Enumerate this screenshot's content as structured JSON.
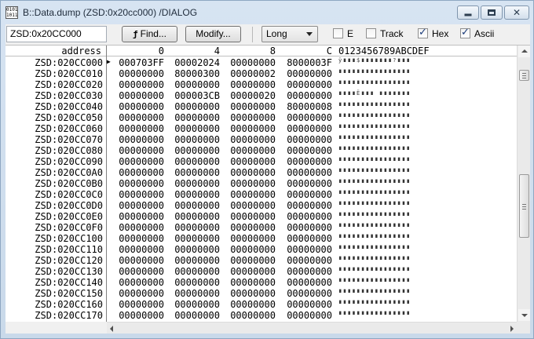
{
  "window": {
    "title": "B::Data.dump (ZSD:0x20cc000) /DIALOG",
    "icon_text": "0101 1011",
    "controls": [
      "minimize",
      "maximize",
      "close"
    ]
  },
  "toolbar": {
    "address_value": "ZSD:0x20CC000",
    "find_label": "Find...",
    "modify_label": "Modify...",
    "width_select": "Long",
    "checkboxes": [
      {
        "label": "E",
        "checked": false
      },
      {
        "label": "Track",
        "checked": false
      },
      {
        "label": "Hex",
        "checked": true
      },
      {
        "label": "Ascii",
        "checked": true
      }
    ]
  },
  "dump": {
    "header": {
      "address": "address",
      "columns": [
        "0",
        "4",
        "8",
        "C"
      ],
      "ascii": "0123456789ABCDEF"
    },
    "rows": [
      {
        "addr": "ZSD:020CC000",
        "words": [
          "000703FF",
          "00002024",
          "00000000",
          "8000003F"
        ],
        "ascii": "ÿ∎∎∎$∎∎∎∎∎∎∎?∎∎∎",
        "current": true
      },
      {
        "addr": "ZSD:020CC010",
        "words": [
          "00000000",
          "80000300",
          "00000002",
          "00000000"
        ],
        "ascii": "∎∎∎∎∎∎∎∎∎∎∎∎∎∎∎∎"
      },
      {
        "addr": "ZSD:020CC020",
        "words": [
          "00000000",
          "00000000",
          "00000000",
          "00000000"
        ],
        "ascii": "∎∎∎∎∎∎∎∎∎∎∎∎∎∎∎∎"
      },
      {
        "addr": "ZSD:020CC030",
        "words": [
          "00000000",
          "000003CB",
          "00000020",
          "00000000"
        ],
        "ascii": "∎∎∎∎Ë∎∎∎ ∎∎∎∎∎∎∎"
      },
      {
        "addr": "ZSD:020CC040",
        "words": [
          "00000000",
          "00000000",
          "00000000",
          "80000008"
        ],
        "ascii": "∎∎∎∎∎∎∎∎∎∎∎∎∎∎∎∎"
      },
      {
        "addr": "ZSD:020CC050",
        "words": [
          "00000000",
          "00000000",
          "00000000",
          "00000000"
        ],
        "ascii": "∎∎∎∎∎∎∎∎∎∎∎∎∎∎∎∎"
      },
      {
        "addr": "ZSD:020CC060",
        "words": [
          "00000000",
          "00000000",
          "00000000",
          "00000000"
        ],
        "ascii": "∎∎∎∎∎∎∎∎∎∎∎∎∎∎∎∎"
      },
      {
        "addr": "ZSD:020CC070",
        "words": [
          "00000000",
          "00000000",
          "00000000",
          "00000000"
        ],
        "ascii": "∎∎∎∎∎∎∎∎∎∎∎∎∎∎∎∎"
      },
      {
        "addr": "ZSD:020CC080",
        "words": [
          "00000000",
          "00000000",
          "00000000",
          "00000000"
        ],
        "ascii": "∎∎∎∎∎∎∎∎∎∎∎∎∎∎∎∎"
      },
      {
        "addr": "ZSD:020CC090",
        "words": [
          "00000000",
          "00000000",
          "00000000",
          "00000000"
        ],
        "ascii": "∎∎∎∎∎∎∎∎∎∎∎∎∎∎∎∎"
      },
      {
        "addr": "ZSD:020CC0A0",
        "words": [
          "00000000",
          "00000000",
          "00000000",
          "00000000"
        ],
        "ascii": "∎∎∎∎∎∎∎∎∎∎∎∎∎∎∎∎"
      },
      {
        "addr": "ZSD:020CC0B0",
        "words": [
          "00000000",
          "00000000",
          "00000000",
          "00000000"
        ],
        "ascii": "∎∎∎∎∎∎∎∎∎∎∎∎∎∎∎∎"
      },
      {
        "addr": "ZSD:020CC0C0",
        "words": [
          "00000000",
          "00000000",
          "00000000",
          "00000000"
        ],
        "ascii": "∎∎∎∎∎∎∎∎∎∎∎∎∎∎∎∎"
      },
      {
        "addr": "ZSD:020CC0D0",
        "words": [
          "00000000",
          "00000000",
          "00000000",
          "00000000"
        ],
        "ascii": "∎∎∎∎∎∎∎∎∎∎∎∎∎∎∎∎"
      },
      {
        "addr": "ZSD:020CC0E0",
        "words": [
          "00000000",
          "00000000",
          "00000000",
          "00000000"
        ],
        "ascii": "∎∎∎∎∎∎∎∎∎∎∎∎∎∎∎∎"
      },
      {
        "addr": "ZSD:020CC0F0",
        "words": [
          "00000000",
          "00000000",
          "00000000",
          "00000000"
        ],
        "ascii": "∎∎∎∎∎∎∎∎∎∎∎∎∎∎∎∎"
      },
      {
        "addr": "ZSD:020CC100",
        "words": [
          "00000000",
          "00000000",
          "00000000",
          "00000000"
        ],
        "ascii": "∎∎∎∎∎∎∎∎∎∎∎∎∎∎∎∎"
      },
      {
        "addr": "ZSD:020CC110",
        "words": [
          "00000000",
          "00000000",
          "00000000",
          "00000000"
        ],
        "ascii": "∎∎∎∎∎∎∎∎∎∎∎∎∎∎∎∎"
      },
      {
        "addr": "ZSD:020CC120",
        "words": [
          "00000000",
          "00000000",
          "00000000",
          "00000000"
        ],
        "ascii": "∎∎∎∎∎∎∎∎∎∎∎∎∎∎∎∎"
      },
      {
        "addr": "ZSD:020CC130",
        "words": [
          "00000000",
          "00000000",
          "00000000",
          "00000000"
        ],
        "ascii": "∎∎∎∎∎∎∎∎∎∎∎∎∎∎∎∎"
      },
      {
        "addr": "ZSD:020CC140",
        "words": [
          "00000000",
          "00000000",
          "00000000",
          "00000000"
        ],
        "ascii": "∎∎∎∎∎∎∎∎∎∎∎∎∎∎∎∎"
      },
      {
        "addr": "ZSD:020CC150",
        "words": [
          "00000000",
          "00000000",
          "00000000",
          "00000000"
        ],
        "ascii": "∎∎∎∎∎∎∎∎∎∎∎∎∎∎∎∎"
      },
      {
        "addr": "ZSD:020CC160",
        "words": [
          "00000000",
          "00000000",
          "00000000",
          "00000000"
        ],
        "ascii": "∎∎∎∎∎∎∎∎∎∎∎∎∎∎∎∎"
      },
      {
        "addr": "ZSD:020CC170",
        "words": [
          "00000000",
          "00000000",
          "00000000",
          "00000000"
        ],
        "ascii": "∎∎∎∎∎∎∎∎∎∎∎∎∎∎∎∎"
      }
    ]
  },
  "scrollbars": {
    "vertical_thumb_position": 0.62,
    "vertical_thumb_fraction": 0.25
  },
  "colors": {
    "title_bar": "#d7e4f2",
    "toolbar": "#f0f0f0",
    "dump_background": "#ffffff",
    "check_tick": "#1b3b7a"
  }
}
